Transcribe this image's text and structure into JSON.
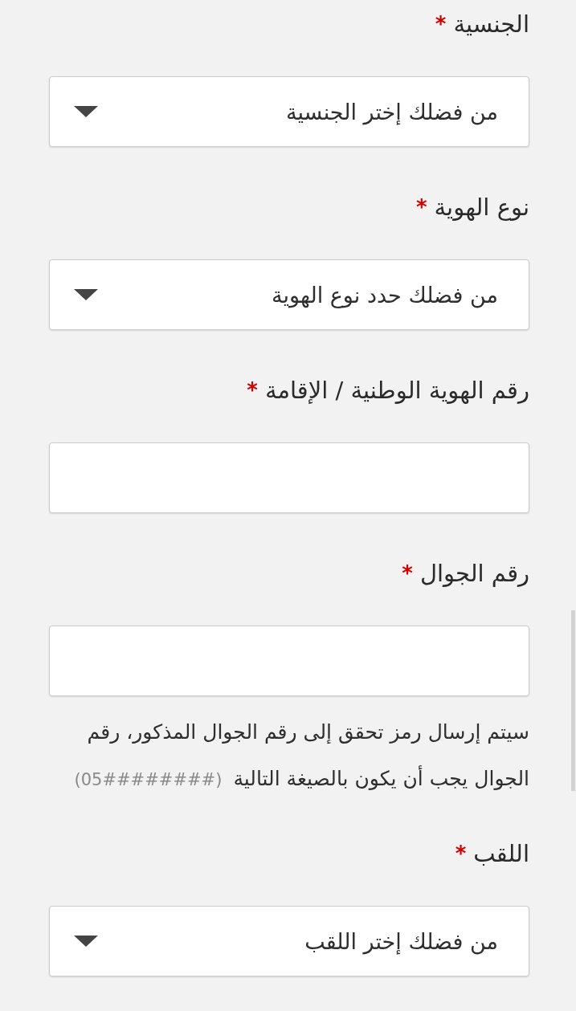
{
  "fields": [
    {
      "kind": "select",
      "label": "الجنسية",
      "required_mark": "*",
      "placeholder": "من فضلك إختر الجنسية"
    },
    {
      "kind": "select",
      "label": "نوع الهوية",
      "required_mark": "*",
      "placeholder": "من فضلك حدد نوع الهوية"
    },
    {
      "kind": "text",
      "label": "رقم الهوية الوطنية / الإقامة",
      "required_mark": "*"
    },
    {
      "kind": "text",
      "label": "رقم الجوال",
      "required_mark": "*",
      "note": {
        "text": "سيتم إرسال رمز تحقق إلى رقم الجوال المذكور، رقم الجوال يجب أن يكون بالصيغة التالية",
        "format": "(05########)"
      }
    },
    {
      "kind": "select",
      "label": "اللقب",
      "required_mark": "*",
      "placeholder": "من فضلك إختر اللقب"
    }
  ]
}
